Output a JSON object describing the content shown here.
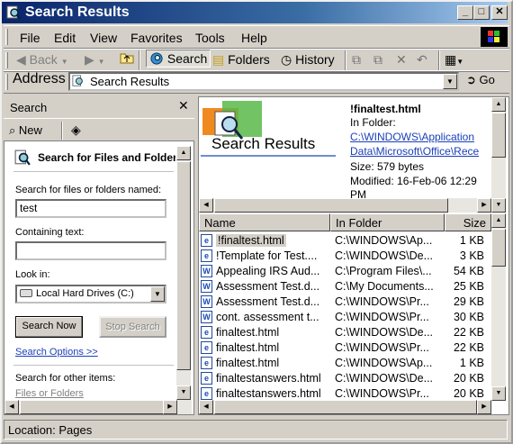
{
  "window": {
    "title": "Search Results",
    "colors": {
      "titlebar_start": "#0a246a",
      "titlebar_end": "#a6caf0",
      "link": "#0000ee",
      "face": "#d4d0c8"
    }
  },
  "menu": [
    "File",
    "Edit",
    "View",
    "Favorites",
    "Tools",
    "Help"
  ],
  "toolbar": {
    "back": "Back",
    "search": "Search",
    "folders": "Folders",
    "history": "History"
  },
  "address": {
    "label": "Address",
    "value": "Search Results",
    "go": "Go"
  },
  "search_pane": {
    "title": "Search",
    "new_label": "New",
    "heading": "Search for Files and Folders",
    "named_label": "Search for files or folders named:",
    "named_value": "test",
    "containing_label": "Containing text:",
    "containing_value": "",
    "lookin_label": "Look in:",
    "lookin_value": "Local Hard Drives (C:)",
    "search_now": "Search Now",
    "stop_search": "Stop Search",
    "options_link": "Search Options >>",
    "other_items_label": "Search for other items:",
    "other_items_link": "Files or Folders"
  },
  "preview": {
    "banner": "Search Results",
    "file_name": "!finaltest.html",
    "in_folder_label": "In Folder:",
    "folder_line1": "C:\\WINDOWS\\Application",
    "folder_line2": "Data\\Microsoft\\Office\\Rece",
    "size": "Size: 579 bytes",
    "modified": "Modified: 16-Feb-06 12:29",
    "modified_cont": "PM"
  },
  "columns": {
    "name": "Name",
    "folder": "In Folder",
    "size": "Size"
  },
  "files": [
    {
      "name": "!finaltest.html",
      "folder": "C:\\WINDOWS\\Ap...",
      "size": "1 KB",
      "icon": "ie-document-icon"
    },
    {
      "name": "!Template for Test....",
      "folder": "C:\\WINDOWS\\De...",
      "size": "3 KB",
      "icon": "ie-document-icon"
    },
    {
      "name": "Appealing IRS Aud...",
      "folder": "C:\\Program Files\\...",
      "size": "54 KB",
      "icon": "word-document-icon"
    },
    {
      "name": "Assessment Test.d...",
      "folder": "C:\\My Documents...",
      "size": "25 KB",
      "icon": "word-document-icon"
    },
    {
      "name": "Assessment Test.d...",
      "folder": "C:\\WINDOWS\\Pr...",
      "size": "29 KB",
      "icon": "word-document-icon"
    },
    {
      "name": "cont. assessment t...",
      "folder": "C:\\WINDOWS\\Pr...",
      "size": "30 KB",
      "icon": "word-document-icon"
    },
    {
      "name": "finaltest.html",
      "folder": "C:\\WINDOWS\\De...",
      "size": "22 KB",
      "icon": "ie-document-icon"
    },
    {
      "name": "finaltest.html",
      "folder": "C:\\WINDOWS\\Pr...",
      "size": "22 KB",
      "icon": "ie-document-icon"
    },
    {
      "name": "finaltest.html",
      "folder": "C:\\WINDOWS\\Ap...",
      "size": "1 KB",
      "icon": "ie-document-icon"
    },
    {
      "name": "finaltestanswers.html",
      "folder": "C:\\WINDOWS\\De...",
      "size": "20 KB",
      "icon": "ie-document-icon"
    },
    {
      "name": "finaltestanswers.html",
      "folder": "C:\\WINDOWS\\Pr...",
      "size": "20 KB",
      "icon": "ie-document-icon"
    }
  ],
  "status": "Location: Pages"
}
